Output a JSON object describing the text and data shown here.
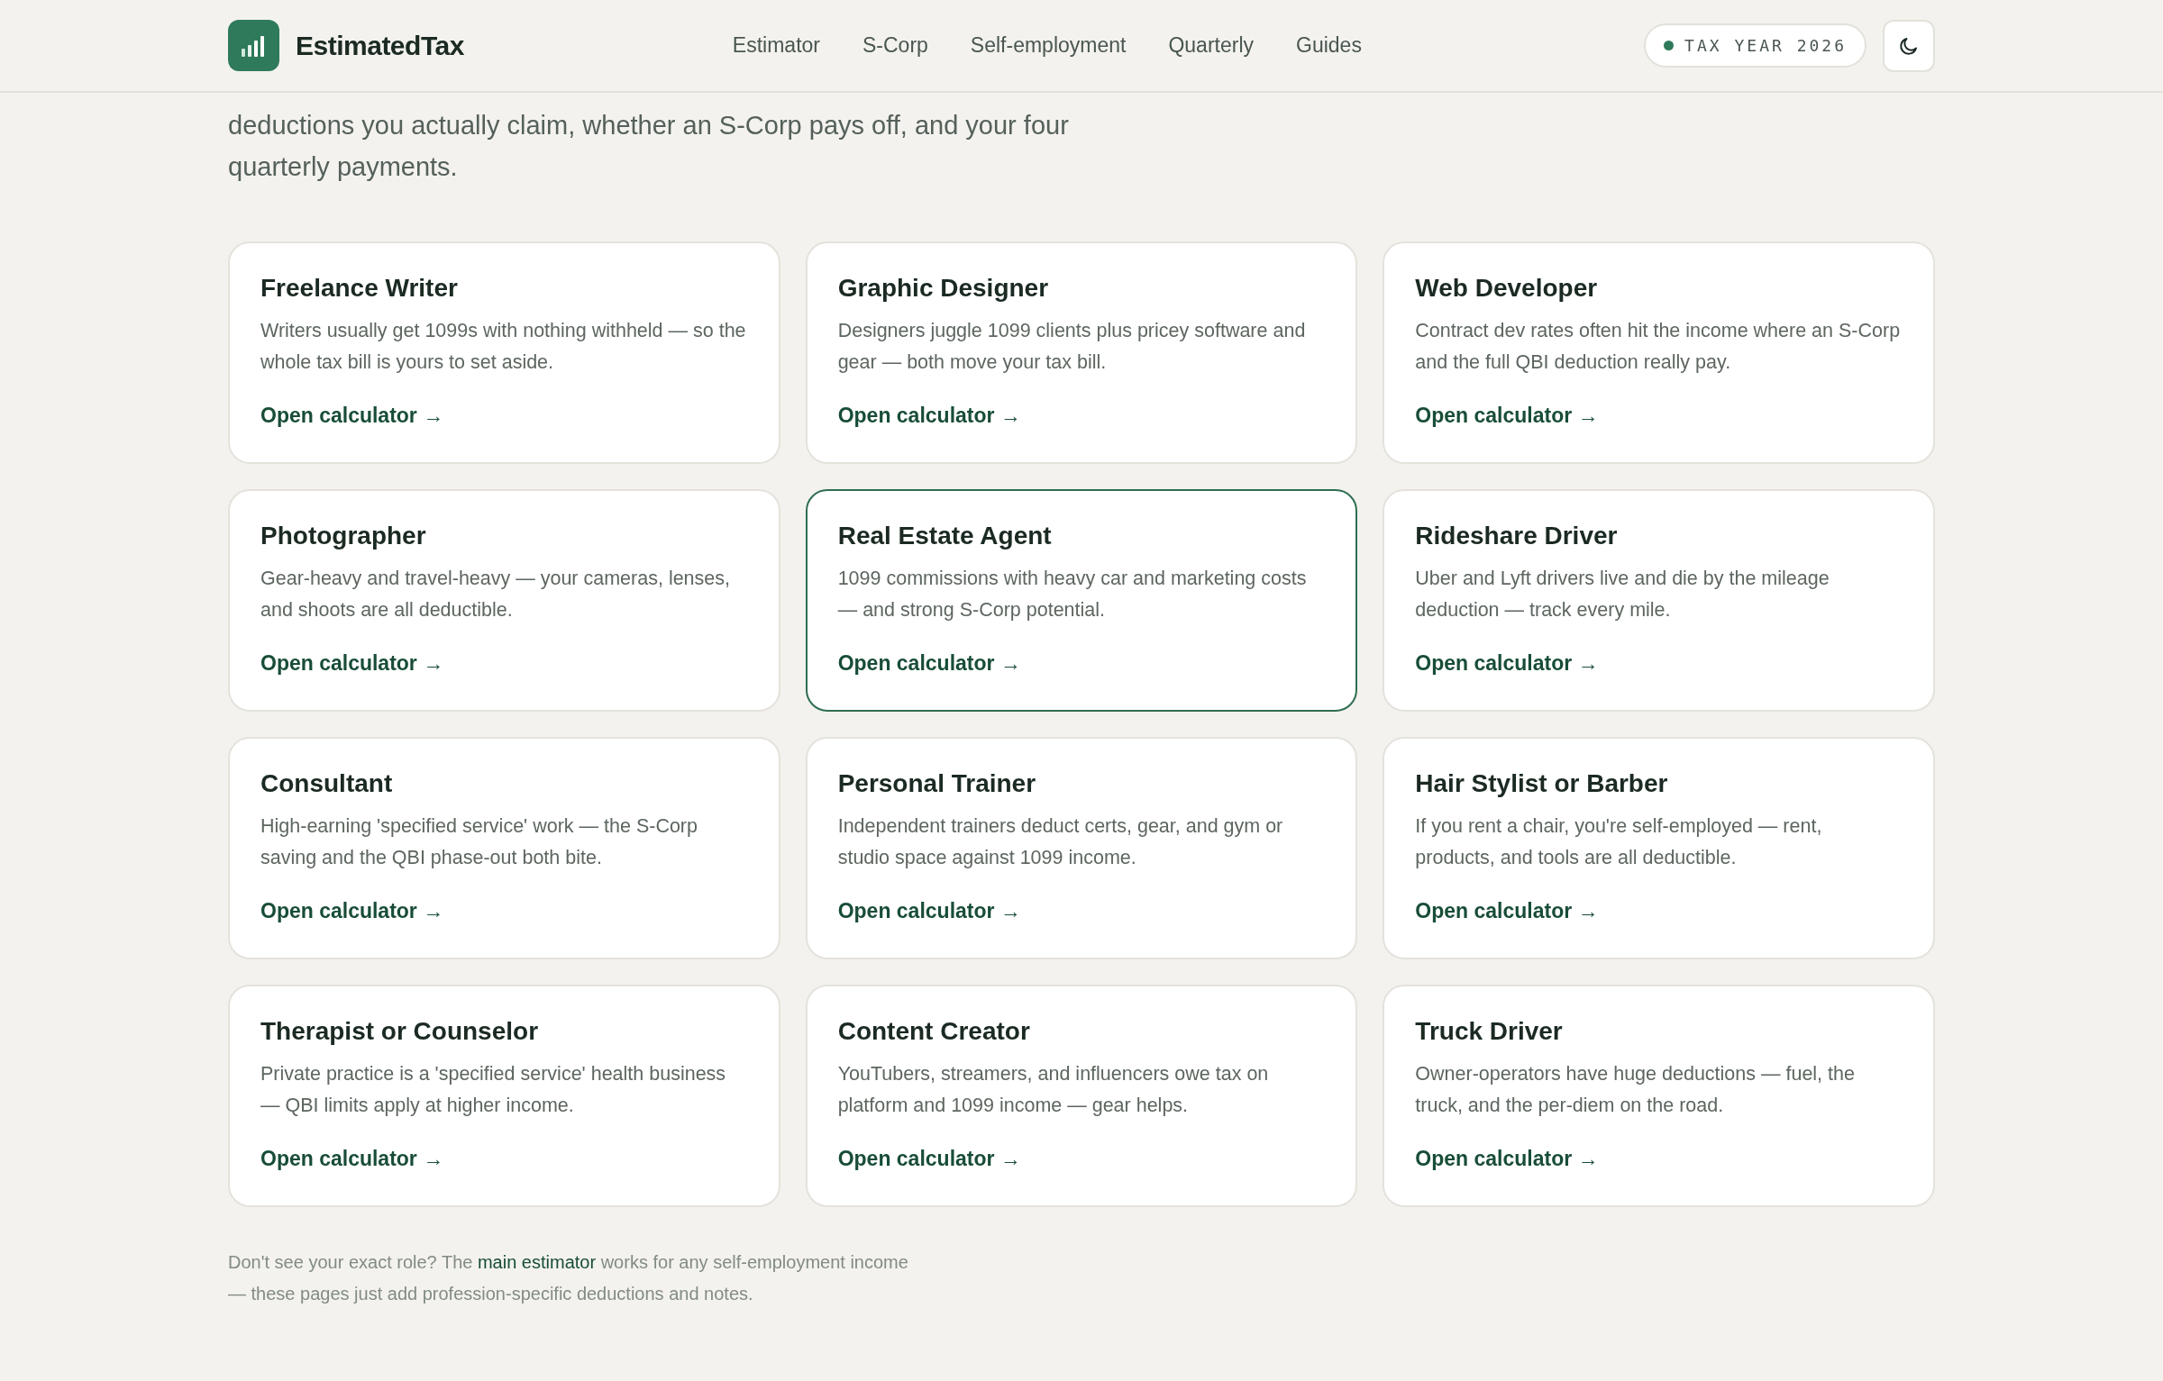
{
  "header": {
    "brand": "EstimatedTax",
    "nav": [
      {
        "label": "Estimator"
      },
      {
        "label": "S-Corp"
      },
      {
        "label": "Self-employment"
      },
      {
        "label": "Quarterly"
      },
      {
        "label": "Guides"
      }
    ],
    "badge": {
      "label": "TAX YEAR 2026",
      "color": "#2e7a5a"
    }
  },
  "intro": "deductions you actually claim, whether an S-Corp pays off, and your four quarterly payments.",
  "cards": [
    {
      "title": "Freelance Writer",
      "text": "Writers usually get 1099s with nothing withheld — so the whole tax bill is yours to set aside.",
      "link": "Open calculator →",
      "selected": false
    },
    {
      "title": "Graphic Designer",
      "text": "Designers juggle 1099 clients plus pricey software and gear — both move your tax bill.",
      "link": "Open calculator →",
      "selected": false
    },
    {
      "title": "Web Developer",
      "text": "Contract dev rates often hit the income where an S-Corp and the full QBI deduction really pay.",
      "link": "Open calculator →",
      "selected": false
    },
    {
      "title": "Photographer",
      "text": "Gear-heavy and travel-heavy — your cameras, lenses, and shoots are all deductible.",
      "link": "Open calculator →",
      "selected": false
    },
    {
      "title": "Real Estate Agent",
      "text": "1099 commissions with heavy car and marketing costs — and strong S-Corp potential.",
      "link": "Open calculator →",
      "selected": true
    },
    {
      "title": "Rideshare Driver",
      "text": "Uber and Lyft drivers live and die by the mileage deduction — track every mile.",
      "link": "Open calculator →",
      "selected": false
    },
    {
      "title": "Consultant",
      "text": "High-earning 'specified service' work — the S-Corp saving and the QBI phase-out both bite.",
      "link": "Open calculator →",
      "selected": false
    },
    {
      "title": "Personal Trainer",
      "text": "Independent trainers deduct certs, gear, and gym or studio space against 1099 income.",
      "link": "Open calculator →",
      "selected": false
    },
    {
      "title": "Hair Stylist or Barber",
      "text": "If you rent a chair, you're self-employed — rent, products, and tools are all deductible.",
      "link": "Open calculator →",
      "selected": false
    },
    {
      "title": "Therapist or Counselor",
      "text": "Private practice is a 'specified service' health business — QBI limits apply at higher income.",
      "link": "Open calculator →",
      "selected": false
    },
    {
      "title": "Content Creator",
      "text": "YouTubers, streamers, and influencers owe tax on platform and 1099 income — gear helps.",
      "link": "Open calculator →",
      "selected": false
    },
    {
      "title": "Truck Driver",
      "text": "Owner-operators have huge deductions — fuel, the truck, and the per-diem on the road.",
      "link": "Open calculator →",
      "selected": false
    }
  ],
  "footer": {
    "before": "Don't see your exact role? The",
    "link": "main estimator",
    "after": "works for any self-employment income — these pages just add profession-specific deductions and notes."
  }
}
